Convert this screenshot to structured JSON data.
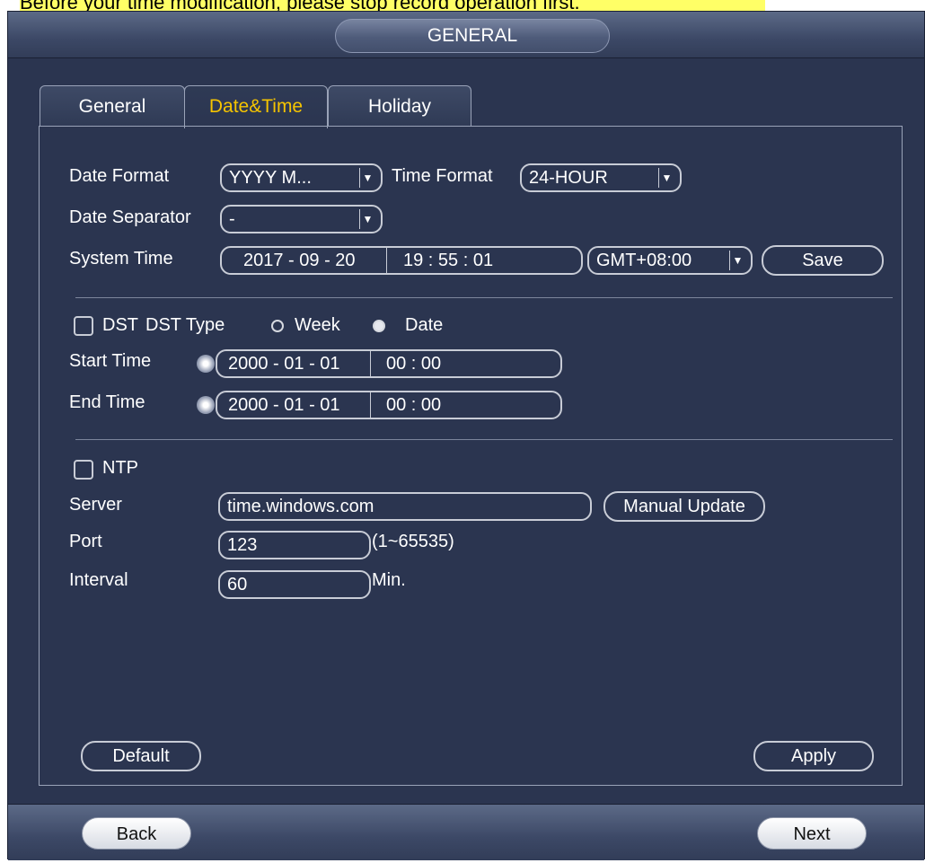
{
  "notice": "Before your time modification, please stop record operation first.",
  "window": {
    "title": "GENERAL"
  },
  "tabs": [
    {
      "label": "General"
    },
    {
      "label": "Date&Time"
    },
    {
      "label": "Holiday"
    }
  ],
  "date_format": {
    "label": "Date Format",
    "value": "YYYY M..."
  },
  "time_format": {
    "label": "Time Format",
    "value": "24-HOUR"
  },
  "date_separator": {
    "label": "Date Separator",
    "value": "-"
  },
  "system_time": {
    "label": "System Time",
    "date": "2017 - 09  - 20",
    "time": "19  : 55  : 01",
    "timezone": "GMT+08:00",
    "save_label": "Save"
  },
  "dst": {
    "label": "DST",
    "type_label": "DST Type",
    "week_label": "Week",
    "date_label": "Date",
    "selected": "Date"
  },
  "start_time": {
    "label": "Start Time",
    "date": "2000   - 01 - 01",
    "time": "00 : 00"
  },
  "end_time": {
    "label": "End Time",
    "date": "2000   - 01 - 01",
    "time": "00 : 00"
  },
  "ntp": {
    "label": "NTP"
  },
  "server": {
    "label": "Server",
    "value": "time.windows.com",
    "update_label": "Manual Update"
  },
  "port": {
    "label": "Port",
    "value": "123",
    "range": "(1~65535)"
  },
  "interval": {
    "label": "Interval",
    "value": "60",
    "unit": "Min."
  },
  "actions": {
    "default_label": "Default",
    "apply_label": "Apply"
  },
  "nav": {
    "back_label": "Back",
    "next_label": "Next"
  }
}
